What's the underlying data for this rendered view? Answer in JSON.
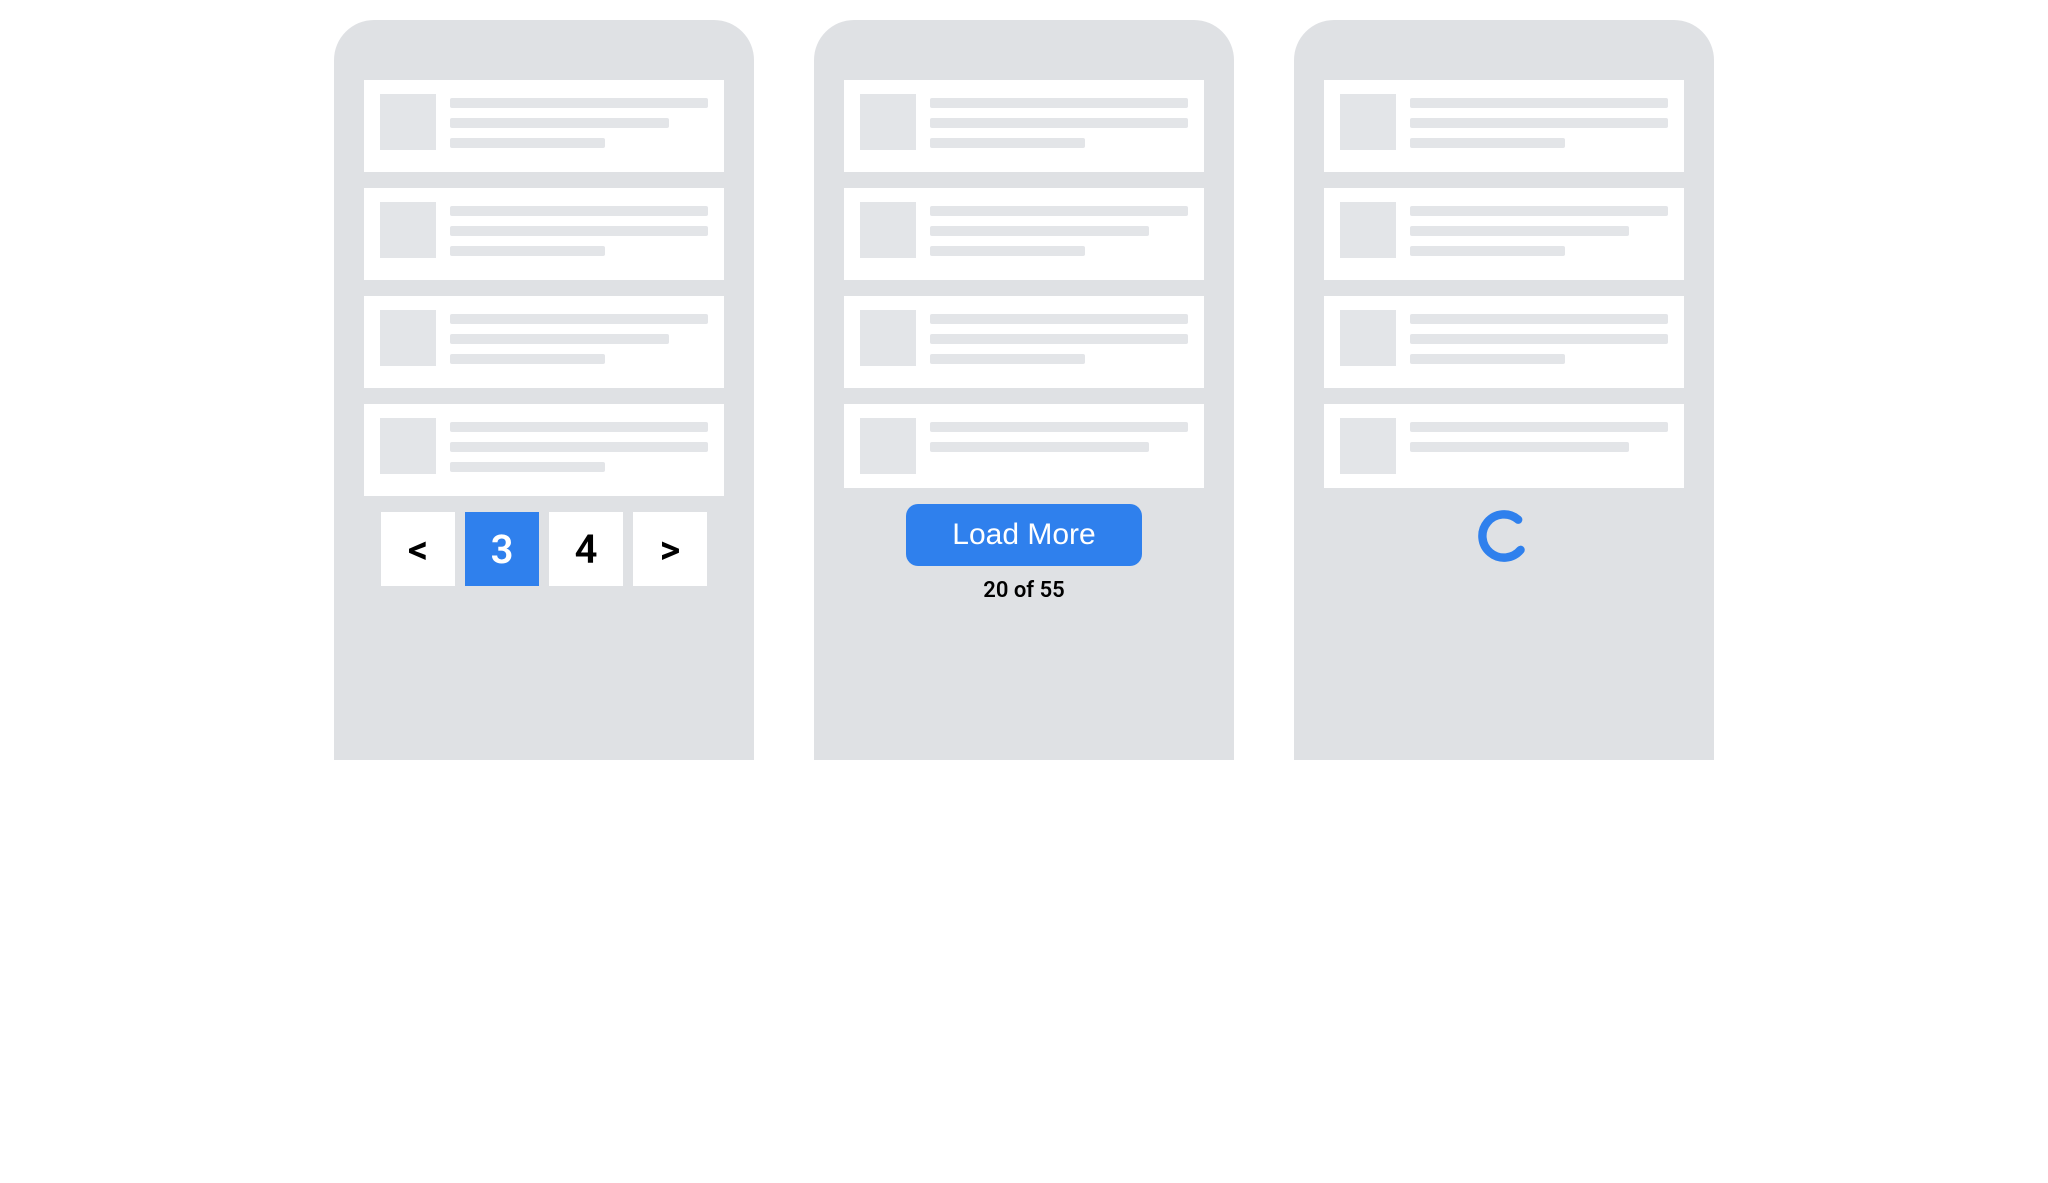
{
  "colors": {
    "accent": "#2f80ed",
    "device": "#dfe1e4",
    "skeleton": "#e3e5e8",
    "card": "#ffffff",
    "text": "#000000"
  },
  "pagination": {
    "prev_label": "<",
    "next_label": ">",
    "current_page": "3",
    "next_page": "4"
  },
  "loadmore": {
    "button_label": "Load More",
    "count_text": "20 of 55"
  },
  "spinner": {
    "name": "loading-spinner-icon"
  }
}
